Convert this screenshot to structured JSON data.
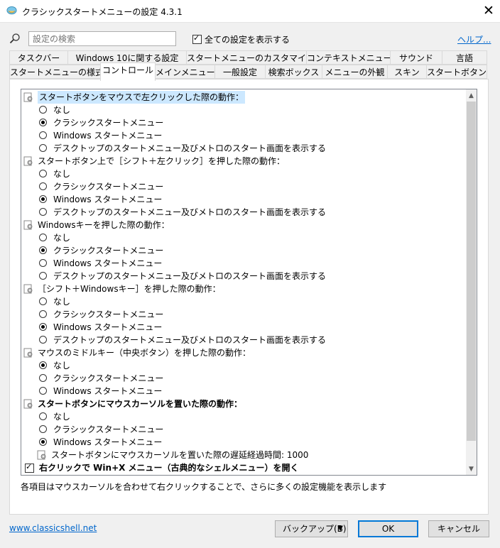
{
  "window": {
    "title": "クラシックスタートメニューの設定 4.3.1",
    "close_glyph": "✕"
  },
  "search": {
    "placeholder": "設定の検索"
  },
  "show_all": {
    "label": "全ての設定を表示する",
    "checked": true
  },
  "help": {
    "label": "ヘルプ..."
  },
  "tabs_row1": [
    "タスクバー",
    "Windows 10に関する設定",
    "スタートメニューのカスタマイズ",
    "コンテキストメニュー",
    "サウンド",
    "言語"
  ],
  "tabs_row2": [
    "スタートメニューの様式",
    "コントロール",
    "メインメニュー",
    "一般設定",
    "検索ボックス",
    "メニューの外観",
    "スキン",
    "スタートボタン"
  ],
  "active_tab": "コントロール",
  "settings": [
    {
      "kind": "header",
      "text": "スタートボタンをマウスで左クリックした際の動作：",
      "highlight": true
    },
    {
      "kind": "radio",
      "text": "なし",
      "selected": false
    },
    {
      "kind": "radio",
      "text": "クラシックスタートメニュー",
      "selected": true
    },
    {
      "kind": "radio",
      "text": "Windows スタートメニュー",
      "selected": false
    },
    {
      "kind": "radio",
      "text": "デスクトップのスタートメニュー及びメトロのスタート画面を表示する",
      "selected": false
    },
    {
      "kind": "header",
      "text": "スタートボタン上で［シフト＋左クリック］を押した際の動作："
    },
    {
      "kind": "radio",
      "text": "なし",
      "selected": false
    },
    {
      "kind": "radio",
      "text": "クラシックスタートメニュー",
      "selected": false
    },
    {
      "kind": "radio",
      "text": "Windows スタートメニュー",
      "selected": true
    },
    {
      "kind": "radio",
      "text": "デスクトップのスタートメニュー及びメトロのスタート画面を表示する",
      "selected": false
    },
    {
      "kind": "header",
      "text": "Windowsキーを押した際の動作："
    },
    {
      "kind": "radio",
      "text": "なし",
      "selected": false
    },
    {
      "kind": "radio",
      "text": "クラシックスタートメニュー",
      "selected": true
    },
    {
      "kind": "radio",
      "text": "Windows スタートメニュー",
      "selected": false
    },
    {
      "kind": "radio",
      "text": "デスクトップのスタートメニュー及びメトロのスタート画面を表示する",
      "selected": false
    },
    {
      "kind": "header",
      "text": "［シフト＋Windowsキー］を押した際の動作："
    },
    {
      "kind": "radio",
      "text": "なし",
      "selected": false
    },
    {
      "kind": "radio",
      "text": "クラシックスタートメニュー",
      "selected": false
    },
    {
      "kind": "radio",
      "text": "Windows スタートメニュー",
      "selected": true
    },
    {
      "kind": "radio",
      "text": "デスクトップのスタートメニュー及びメトロのスタート画面を表示する",
      "selected": false
    },
    {
      "kind": "header",
      "text": "マウスのミドルキー（中央ボタン）を押した際の動作："
    },
    {
      "kind": "radio",
      "text": "なし",
      "selected": true
    },
    {
      "kind": "radio",
      "text": "クラシックスタートメニュー",
      "selected": false
    },
    {
      "kind": "radio",
      "text": "Windows スタートメニュー",
      "selected": false
    },
    {
      "kind": "header",
      "text": "スタートボタンにマウスカーソルを置いた際の動作：",
      "bold": true
    },
    {
      "kind": "radio",
      "text": "なし",
      "selected": false
    },
    {
      "kind": "radio",
      "text": "クラシックスタートメニュー",
      "selected": false
    },
    {
      "kind": "radio",
      "text": "Windows スタートメニュー",
      "selected": true
    },
    {
      "kind": "subsetting",
      "text": "スタートボタンにマウスカーソルを置いた際の遅延経過時間: 1000"
    },
    {
      "kind": "checkbox",
      "text": "右クリックで Win+X メニュー（古典的なシェルメニュー）を開く",
      "checked": true,
      "bold": true
    }
  ],
  "hint": "各項目はマウスカーソルを合わせて右クリックすることで、さらに多くの設定機能を表示します",
  "footer": {
    "site_link": "www.classicshell.net",
    "backup_label": "バックアップ(B)",
    "ok_label": "OK",
    "cancel_label": "キャンセル"
  },
  "icons": {
    "app": "classic-shell-shell-icon",
    "search": "magnifier-icon",
    "setting": "settings-page-gear-icon",
    "scroll_up": "chevron-up-icon",
    "scroll_down": "chevron-down-icon",
    "dropdown": "triangle-down-icon"
  },
  "colors": {
    "accent": "#0078d7",
    "link": "#0066cc",
    "highlight": "#cce8ff"
  }
}
